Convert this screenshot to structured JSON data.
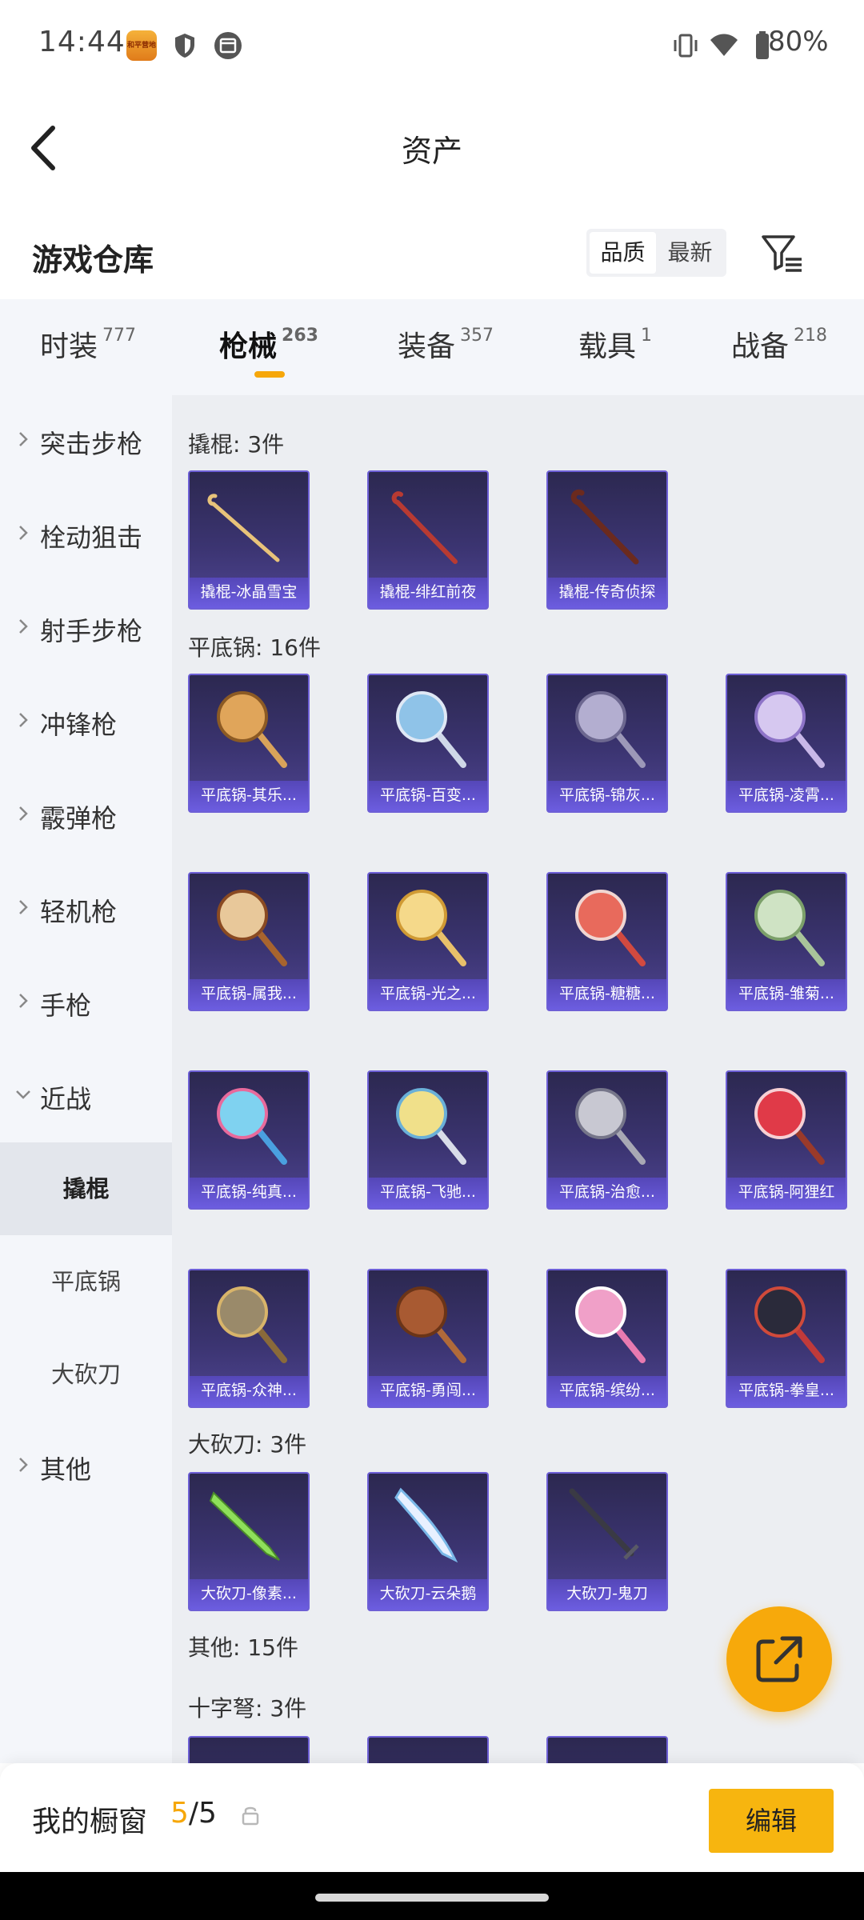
{
  "status_bar": {
    "time": "14:44",
    "app_badge": "和平营地",
    "battery": "80%",
    "icons": [
      "shield-icon",
      "calendar-icon",
      "vibrate-icon",
      "wifi-icon",
      "battery-icon"
    ]
  },
  "header": {
    "title": "资产"
  },
  "warehouse": {
    "title": "游戏仓库",
    "sort_quality": "品质",
    "sort_newest": "最新"
  },
  "tabs": [
    {
      "label": "时装",
      "count": "777"
    },
    {
      "label": "枪械",
      "count": "263"
    },
    {
      "label": "装备",
      "count": "357"
    },
    {
      "label": "载具",
      "count": "1"
    },
    {
      "label": "战备",
      "count": "218"
    }
  ],
  "active_tab": "枪械",
  "sidebar": {
    "items": [
      {
        "label": "突击步枪"
      },
      {
        "label": "栓动狙击"
      },
      {
        "label": "射手步枪"
      },
      {
        "label": "冲锋枪"
      },
      {
        "label": "霰弹枪"
      },
      {
        "label": "轻机枪"
      },
      {
        "label": "手枪"
      },
      {
        "label": "近战"
      }
    ],
    "sub_items": [
      {
        "label": "撬棍"
      },
      {
        "label": "平底锅"
      },
      {
        "label": "大砍刀"
      }
    ],
    "last_item": {
      "label": "其他"
    }
  },
  "sections": {
    "crowbar": {
      "title": "撬棍: 3件",
      "items": [
        "撬棍-冰晶雪宝",
        "撬棍-绯红前夜",
        "撬棍-传奇侦探"
      ]
    },
    "pan": {
      "title": "平底锅: 16件",
      "items": [
        "平底锅-其乐...",
        "平底锅-百变...",
        "平底锅-锦灰...",
        "平底锅-凌霄...",
        "平底锅-属我...",
        "平底锅-光之...",
        "平底锅-糖糖...",
        "平底锅-雏菊...",
        "平底锅-纯真...",
        "平底锅-飞驰...",
        "平底锅-治愈...",
        "平底锅-阿狸红",
        "平底锅-众神...",
        "平底锅-勇闯...",
        "平底锅-缤纷...",
        "平底锅-拳皇..."
      ]
    },
    "machete": {
      "title": "大砍刀: 3件",
      "items": [
        "大砍刀-像素...",
        "大砍刀-云朵鹅",
        "大砍刀-鬼刀"
      ]
    },
    "other": {
      "title": "其他: 15件"
    },
    "crossbow": {
      "title": "十字弩: 3件"
    }
  },
  "bottom_bar": {
    "label": "我的橱窗",
    "current": "5",
    "separator": "/",
    "total": "5",
    "edit": "编辑"
  },
  "colors": {
    "accent": "#f6a70a",
    "card_bg": "#3b3471",
    "card_caption": "#6c5de0"
  }
}
